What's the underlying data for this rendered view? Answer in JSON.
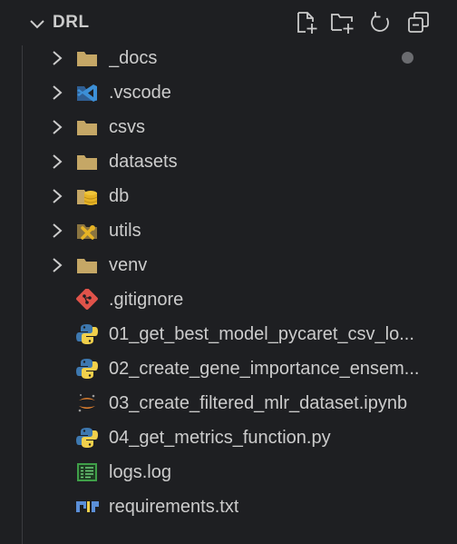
{
  "explorer": {
    "folder_name": "DRL",
    "actions": [
      "new-file",
      "new-folder",
      "refresh",
      "collapse-all"
    ]
  },
  "tree": {
    "folders": [
      {
        "label": "_docs",
        "icon": "folder-icon"
      },
      {
        "label": ".vscode",
        "icon": "vscode-icon"
      },
      {
        "label": "csvs",
        "icon": "folder-icon"
      },
      {
        "label": "datasets",
        "icon": "folder-icon"
      },
      {
        "label": "db",
        "icon": "database-folder-icon"
      },
      {
        "label": "utils",
        "icon": "tools-folder-icon"
      },
      {
        "label": "venv",
        "icon": "folder-icon"
      }
    ],
    "files": [
      {
        "label": ".gitignore",
        "icon": "git-icon"
      },
      {
        "label": "01_get_best_model_pycaret_csv_lo...",
        "icon": "python-icon"
      },
      {
        "label": "02_create_gene_importance_ensem...",
        "icon": "python-icon"
      },
      {
        "label": "03_create_filtered_mlr_dataset.ipynb",
        "icon": "jupyter-icon"
      },
      {
        "label": "04_get_metrics_function.py",
        "icon": "python-icon"
      },
      {
        "label": "logs.log",
        "icon": "log-icon"
      },
      {
        "label": "requirements.txt",
        "icon": "pip-icon"
      }
    ]
  },
  "colors": {
    "background": "#1e1f22",
    "folder": "#c5a766",
    "vscode_blue": "#3c8fd6",
    "git_red": "#e0534a",
    "python_blue": "#3d78b0",
    "python_yellow": "#f1d04b",
    "jupyter_orange": "#e0802e",
    "log_green": "#3f9f48",
    "pip_blue": "#5b8fd8"
  }
}
